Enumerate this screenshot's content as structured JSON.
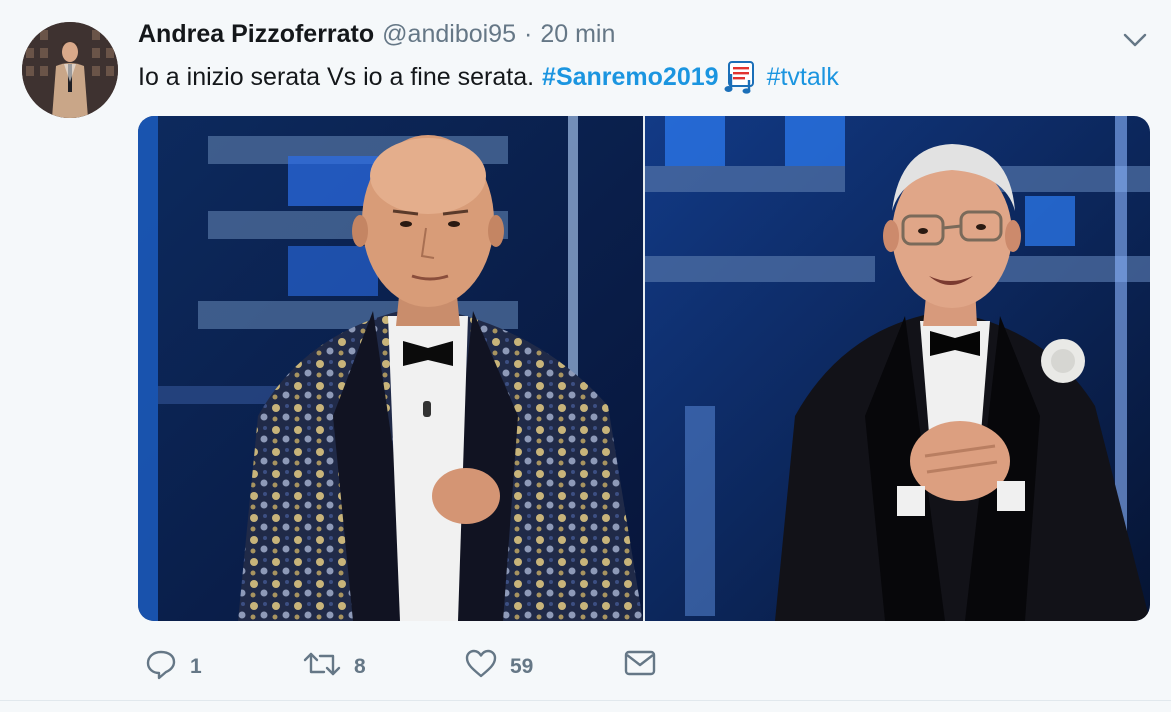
{
  "tweet": {
    "author_name": "Andrea Pizzoferrato",
    "handle": "@andiboi95",
    "separator": "·",
    "time": "20 min",
    "text": "Io a inizio serata Vs io a fine serata.",
    "hashtags": [
      "#Sanremo2019",
      "#tvtalk"
    ],
    "hashtag_emoji": "sanremo-music-score-icon",
    "menu_icon": "chevron-down-icon"
  },
  "media": {
    "photos": [
      {
        "name": "left-photo",
        "description_icon": "host-in-sequin-tuxedo-image"
      },
      {
        "name": "right-photo",
        "description_icon": "elderly-host-in-black-tuxedo-image"
      }
    ]
  },
  "actions": {
    "reply_count": "1",
    "retweet_count": "8",
    "like_count": "59"
  },
  "colors": {
    "background": "#f5f8fa",
    "text": "#14171a",
    "secondary": "#657786",
    "link": "#1b95e0"
  }
}
